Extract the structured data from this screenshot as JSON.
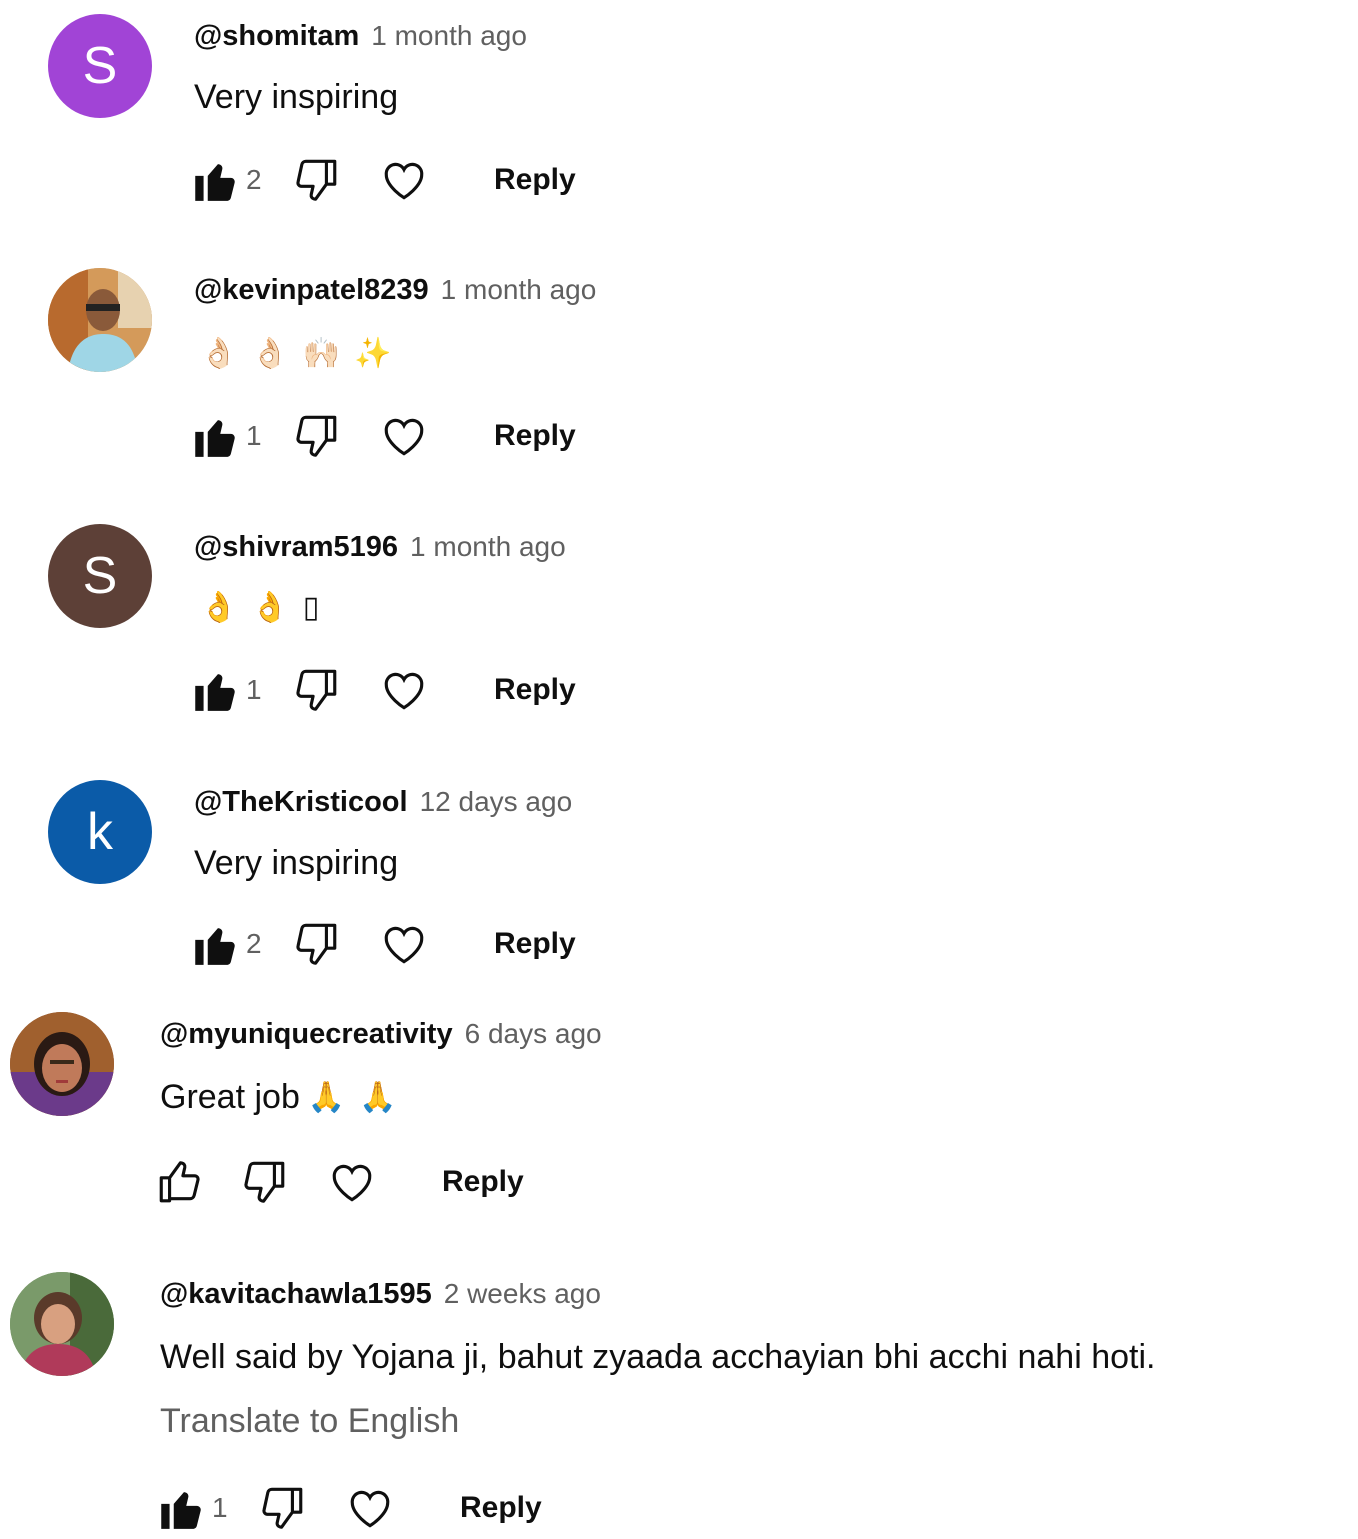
{
  "comments": [
    {
      "handle": "@shomitam",
      "time": "1 month ago",
      "avatar_letter": "S",
      "avatar_color": "#a144d6",
      "text": "Very inspiring",
      "likes": "2",
      "reply_label": "Reply"
    },
    {
      "handle": "@kevinpatel8239",
      "time": "1 month ago",
      "avatar_letter": "",
      "avatar_color": "#c9b18d",
      "emojis": [
        "👌🏻",
        "👌🏻",
        "🙌🏻",
        "✨"
      ],
      "likes": "1",
      "reply_label": "Reply"
    },
    {
      "handle": "@shivram5196",
      "time": "1 month ago",
      "avatar_letter": "S",
      "avatar_color": "#5d4037",
      "emojis": [
        "👌",
        "👌",
        "▯"
      ],
      "likes": "1",
      "reply_label": "Reply"
    },
    {
      "handle": "@TheKristicool",
      "time": "12 days ago",
      "avatar_letter": "k",
      "avatar_color": "#0b5ba8",
      "text": "Very inspiring",
      "likes": "2",
      "reply_label": "Reply"
    },
    {
      "handle": "@myuniquecreativity",
      "time": "6 days ago",
      "avatar_letter": "",
      "avatar_color": "#8a4a2a",
      "text": "Great job",
      "emojis": [
        "🙏",
        "🙏"
      ],
      "likes": "",
      "reply_label": "Reply"
    },
    {
      "handle": "@kavitachawla1595",
      "time": "2 weeks ago",
      "avatar_letter": "",
      "avatar_color": "#6f8f5e",
      "text": "Well said by Yojana ji, bahut zyaada acchayian bhi acchi nahi hoti.",
      "translate_label": "Translate to English",
      "likes": "1",
      "reply_label": "Reply"
    }
  ],
  "icons": {
    "like_filled": "thumb-up-filled-icon",
    "like_outline": "thumb-up-outline-icon",
    "dislike": "thumb-down-outline-icon",
    "heart": "heart-outline-icon"
  }
}
